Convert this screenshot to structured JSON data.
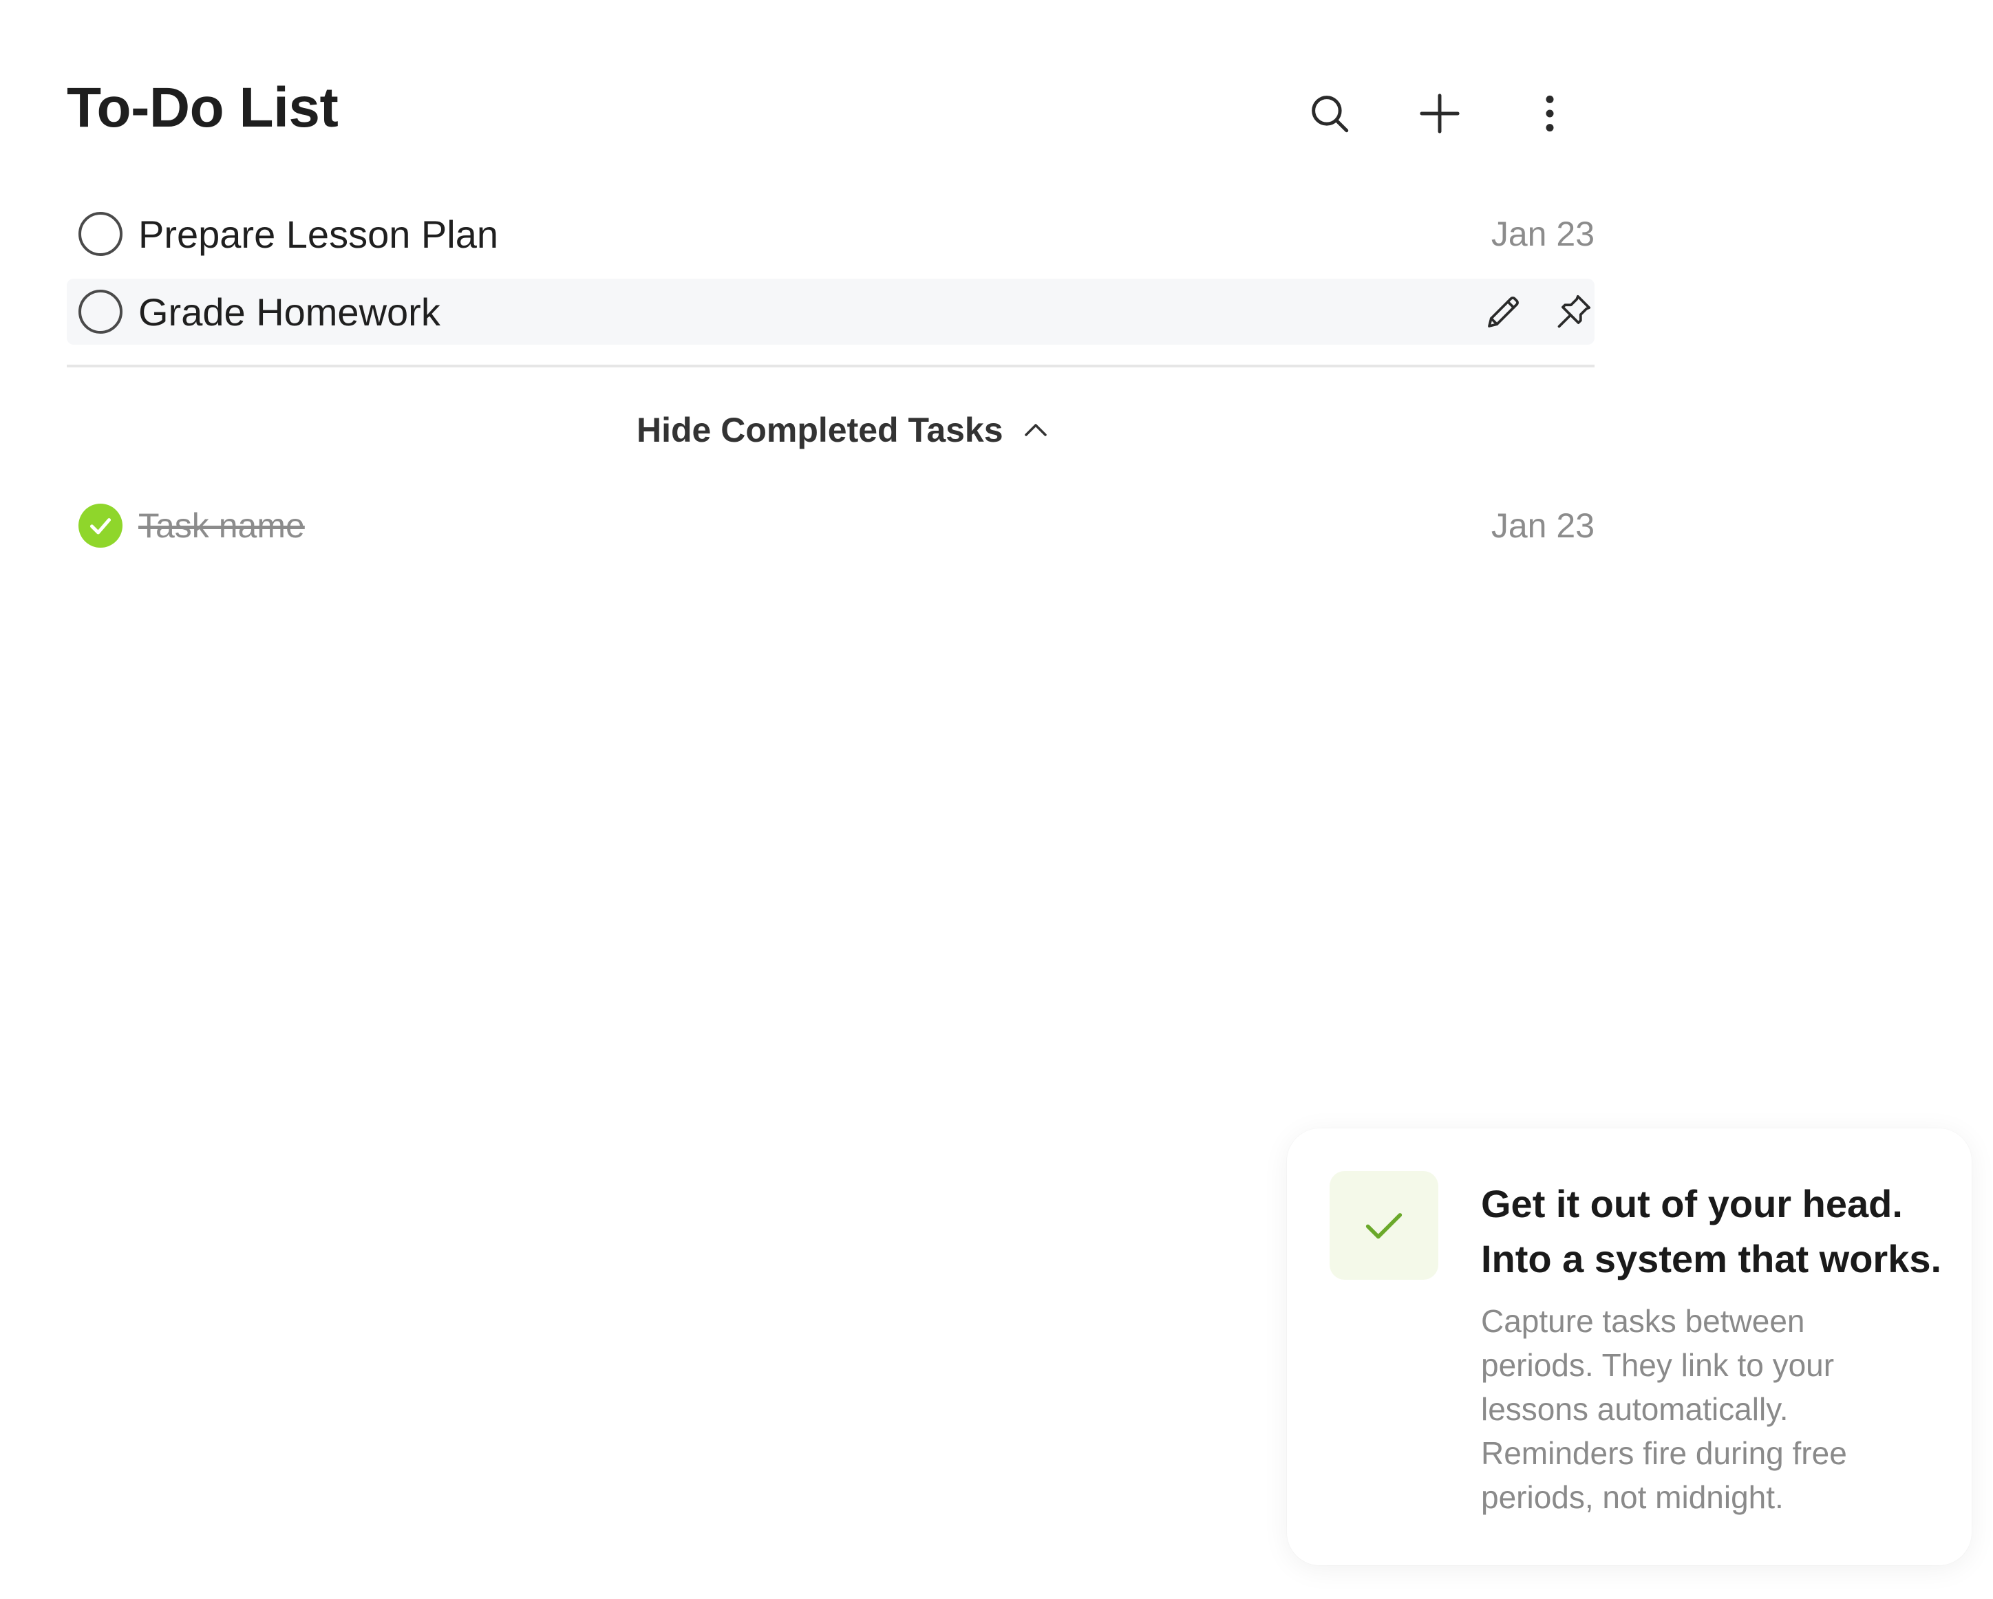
{
  "header": {
    "title": "To-Do List",
    "icons": [
      "search-icon",
      "plus-icon",
      "more-vertical-icon"
    ]
  },
  "tasks": [
    {
      "name": "Prepare Lesson Plan",
      "date": "Jan 23",
      "completed": false
    },
    {
      "name": "Grade Homework",
      "date": "",
      "completed": false,
      "hovered": true,
      "actions": [
        "pencil-icon",
        "pin-icon"
      ]
    }
  ],
  "completed_toggle": {
    "label": "Hide Completed Tasks",
    "icon": "chevron-up-icon"
  },
  "completed_tasks": [
    {
      "name": "Task name",
      "date": "Jan 23",
      "completed": true
    }
  ],
  "onboarding_card": {
    "icon": "check-icon",
    "title_line1": "Get it out of your head.",
    "title_line2": "Into a system that works.",
    "body": "Capture tasks between periods. They link to your lessons automatically. Reminders fire during free periods, not midnight."
  },
  "colors": {
    "accent_green": "#8fd62b",
    "check_green": "#6aa92a",
    "muted_text": "#8c8c8c",
    "hover_row_bg": "#f6f7f9"
  }
}
